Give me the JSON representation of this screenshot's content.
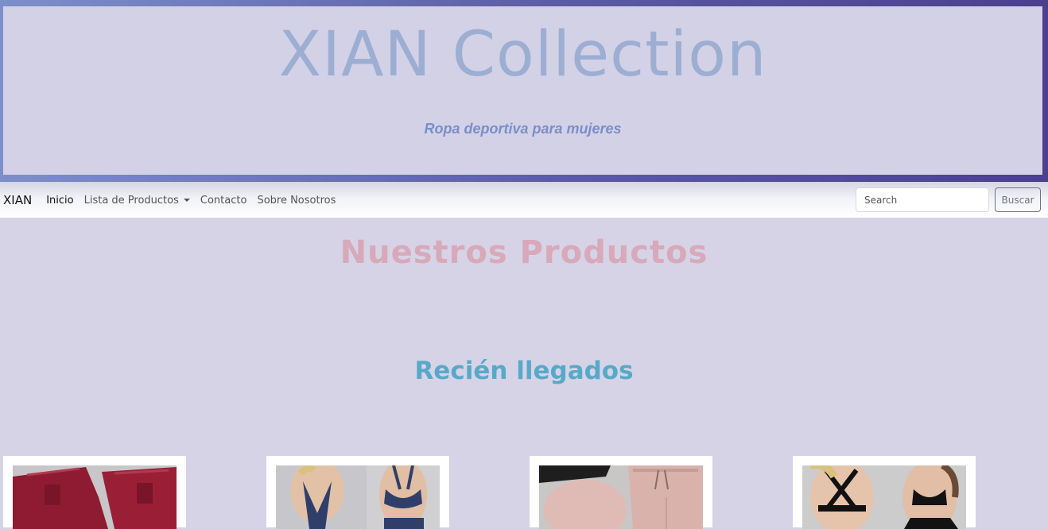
{
  "header": {
    "title": "XIAN Collection",
    "subtitle": "Ropa deportiva para mujeres"
  },
  "navbar": {
    "brand": "XIAN",
    "links": [
      {
        "label": "Inicio",
        "active": true
      },
      {
        "label": "Lista de Productos",
        "dropdown": true
      },
      {
        "label": "Contacto"
      },
      {
        "label": "Sobre Nosotros"
      }
    ],
    "search_placeholder": "Search",
    "search_button": "Buscar"
  },
  "main": {
    "title": "Nuestros Productos",
    "new_arrivals": "Recién llegados"
  },
  "colors": {
    "banner_gradient": [
      "#7d8fcb",
      "#4b3f8e"
    ],
    "page_bg": "#d6d3e6",
    "title": "#9daed3",
    "subtitle": "#7b8ec9",
    "section_title": "#d7a9b9",
    "new_arrivals": "#58a9c9"
  }
}
